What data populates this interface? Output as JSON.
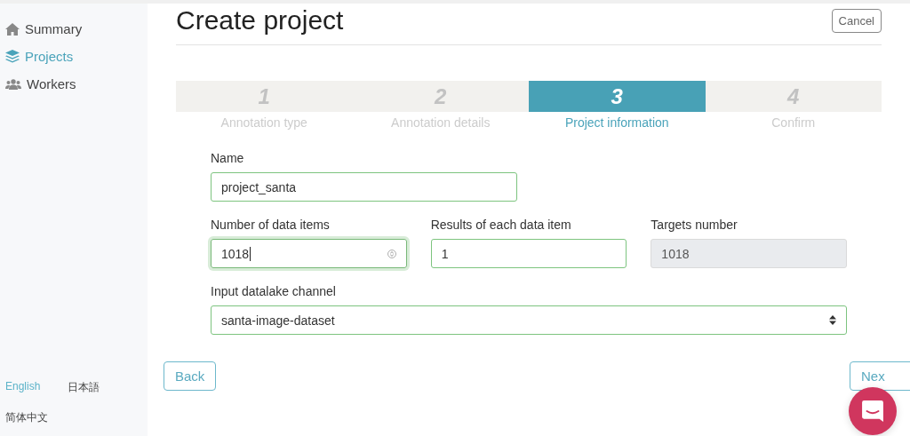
{
  "sidebar": {
    "items": [
      {
        "label": "Summary",
        "kind": "home",
        "selected": false
      },
      {
        "label": "Projects",
        "kind": "layers",
        "selected": true
      },
      {
        "label": "Workers",
        "kind": "users",
        "selected": false
      }
    ],
    "languages": [
      {
        "label": "English",
        "selected": true
      },
      {
        "label": "日本語",
        "selected": false
      },
      {
        "label": "简体中文",
        "selected": false
      }
    ]
  },
  "page": {
    "title": "Create project",
    "cancel": "Cancel"
  },
  "steps": [
    {
      "number": "1",
      "label": "Annotation type",
      "selected": false
    },
    {
      "number": "2",
      "label": "Annotation details",
      "selected": false
    },
    {
      "number": "3",
      "label": "Project information",
      "selected": true
    },
    {
      "number": "4",
      "label": "Confirm",
      "selected": false
    }
  ],
  "form": {
    "rows": [
      [
        {
          "label": "Name",
          "kind": "text",
          "value": "project_santa",
          "focused": false
        }
      ],
      [
        {
          "label": "Number of data items",
          "kind": "number",
          "value": "1018",
          "focused": true
        },
        {
          "label": "Results of each data item",
          "kind": "text",
          "value": "1",
          "focused": false
        },
        {
          "label": "Targets number",
          "kind": "readonly",
          "value": "1018",
          "focused": false
        }
      ],
      [
        {
          "label": "Input datalake channel",
          "kind": "select",
          "value": "santa-image-dataset",
          "focused": false
        }
      ]
    ]
  },
  "buttons": {
    "back": "Back",
    "next": "Nex"
  }
}
